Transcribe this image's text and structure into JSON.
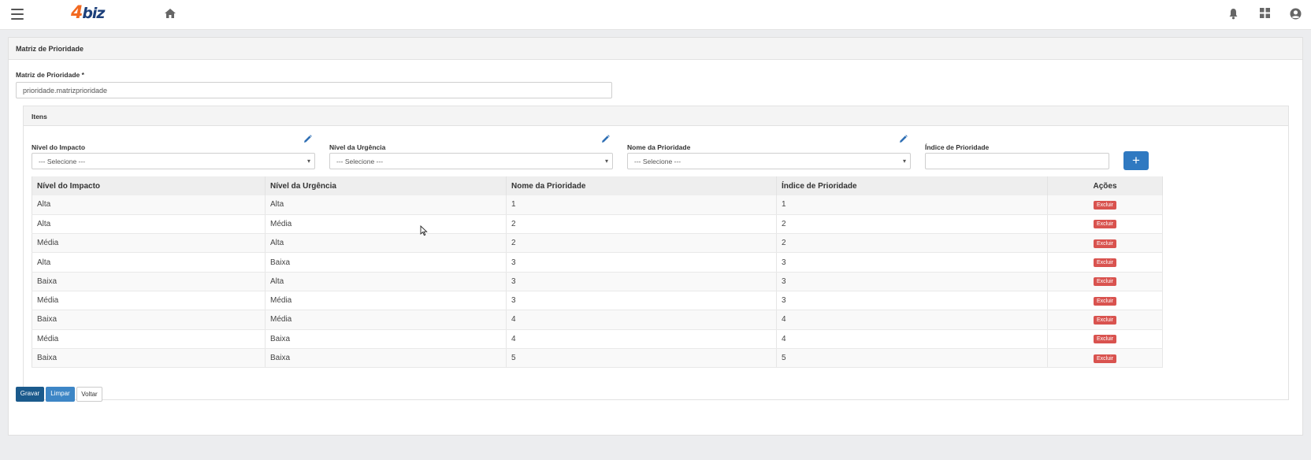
{
  "brand": {
    "logo_four": "4",
    "logo_biz": "biz",
    "color_orange": "#f26a21",
    "color_navy": "#1c3f7a"
  },
  "topbar": {
    "icons": [
      "hamburger-menu-icon",
      "home-icon",
      "bell-icon",
      "apps-grid-icon",
      "user-avatar-icon"
    ]
  },
  "page": {
    "title": "Matriz de Prioridade",
    "field_label": "Matriz de Prioridade *",
    "field_value": "prioridade.matrizprioridade"
  },
  "items": {
    "title": "Itens",
    "filters": {
      "impacto_label": "Nível do Impacto",
      "urgencia_label": "Nível da Urgência",
      "prioridade_label": "Nome da Prioridade",
      "indice_label": "Índice de Prioridade",
      "select_placeholder": "--- Selecione ---",
      "indice_value": "",
      "add_label": "+"
    },
    "columns": [
      "Nível do Impacto",
      "Nível da Urgência",
      "Nome da Prioridade",
      "Índice de Prioridade",
      "Ações"
    ],
    "delete_label": "Excluir",
    "rows": [
      [
        "Alta",
        "Alta",
        "1",
        "1"
      ],
      [
        "Alta",
        "Média",
        "2",
        "2"
      ],
      [
        "Média",
        "Alta",
        "2",
        "2"
      ],
      [
        "Alta",
        "Baixa",
        "3",
        "3"
      ],
      [
        "Baixa",
        "Alta",
        "3",
        "3"
      ],
      [
        "Média",
        "Média",
        "3",
        "3"
      ],
      [
        "Baixa",
        "Média",
        "4",
        "4"
      ],
      [
        "Média",
        "Baixa",
        "4",
        "4"
      ],
      [
        "Baixa",
        "Baixa",
        "5",
        "5"
      ]
    ]
  },
  "actions": {
    "gravar": "Gravar",
    "limpar": "Limpar",
    "voltar": "Voltar"
  },
  "colors": {
    "primary": "#2f79c1",
    "danger": "#d9534f",
    "dark_primary": "#1b5a8c"
  }
}
